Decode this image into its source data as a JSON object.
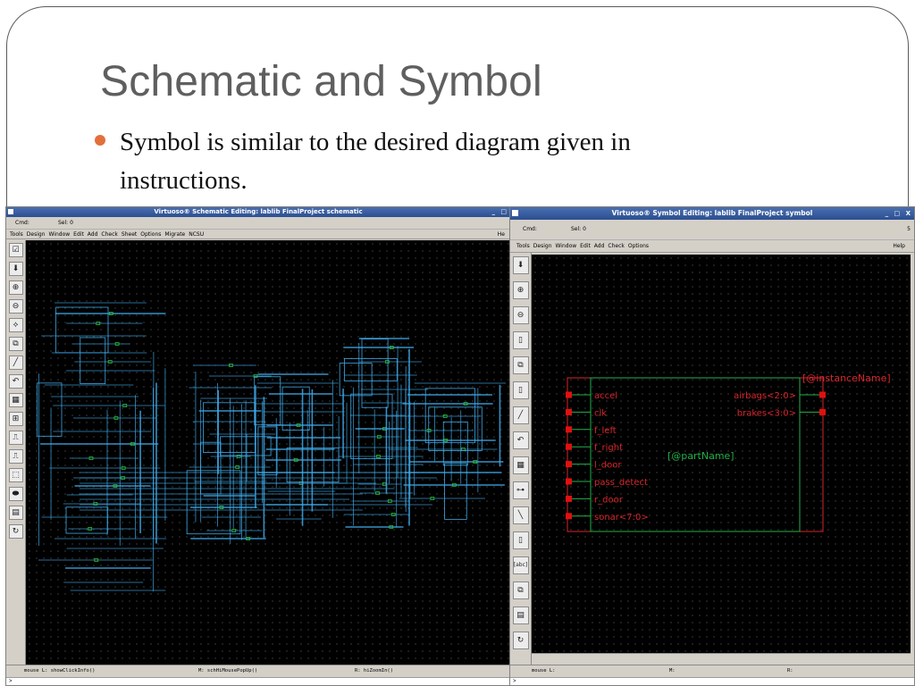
{
  "slide": {
    "title": "Schematic and Symbol",
    "bullet": "Symbol is similar to the desired diagram given in instructions."
  },
  "schematic_window": {
    "title": "Virtuoso® Schematic Editing: lablib FinalProject schematic",
    "title_controls": "_ □",
    "cmd_label": "Cmd:",
    "sel_label": "Sel: 0",
    "menu": [
      "Tools",
      "Design",
      "Window",
      "Edit",
      "Add",
      "Check",
      "Sheet",
      "Options",
      "Migrate",
      "NCSU"
    ],
    "menu_right": "He",
    "tool_icons": [
      "check-icon",
      "descend-icon",
      "zoom-in-icon",
      "zoom-out-icon",
      "stretch-icon",
      "copy-icon",
      "wire-icon",
      "undo-icon",
      "grid-icon",
      "property-icon",
      "pin-icon",
      "net-icon",
      "label-icon",
      "instance-icon",
      "window-icon",
      "refresh-icon"
    ],
    "tool_glyphs": [
      "☑",
      "⬇",
      "⊕",
      "⊖",
      "⟡",
      "⧉",
      "╱",
      "↶",
      "▦",
      "⊞",
      "⎍",
      "⎍",
      "⬚",
      "⬬",
      "▤",
      "↻"
    ],
    "status_left": "mouse L: showClickInfo()",
    "status_middle": "M: schHiMousePopUp()",
    "status_right": "R: hiZoomIn()",
    "prompt": ">",
    "wire_color": "#3fa9e8",
    "pin_color": "#2bd42b"
  },
  "symbol_window": {
    "title": "Virtuoso® Symbol Editing: lablib FinalProject symbol",
    "title_controls": "_ □ X",
    "cmd_label": "Cmd:",
    "sel_label": "Sel: 0",
    "cmd_right": "5",
    "menu": [
      "Tools",
      "Design",
      "Window",
      "Edit",
      "Add",
      "Check",
      "Options"
    ],
    "menu_right": "Help",
    "tool_icons": [
      "descend-icon",
      "zoom-in-icon",
      "zoom-out-icon",
      "stretch-icon",
      "copy-icon",
      "delete-icon",
      "wire-icon",
      "undo-icon",
      "grid-icon",
      "pin-icon",
      "line-icon",
      "rectangle-icon",
      "label-icon",
      "window-icon",
      "page-icon",
      "refresh-icon"
    ],
    "tool_glyphs": [
      "⬇",
      "⊕",
      "⊖",
      "▯",
      "⧉",
      "▯",
      "╱",
      "↶",
      "▦",
      "⊶",
      "╲",
      "▯",
      "[abc]",
      "⧉",
      "▤",
      "↻"
    ],
    "status_left": "mouse L:",
    "status_middle": "M:",
    "status_right": "R:",
    "prompt": ">",
    "instance_name": "[@instanceName]",
    "part_name": "[@partName]",
    "input_pins": [
      "accel",
      "clk",
      "f_left",
      "f_right",
      "l_door",
      "pass_detect",
      "r_door",
      "sonar<7:0>"
    ],
    "output_pins": [
      "airbags<2:0>",
      "brakes<3:0>"
    ],
    "label_color": "#d8262c",
    "body_color": "#22b04b",
    "pin_square_color": "#e01010"
  }
}
